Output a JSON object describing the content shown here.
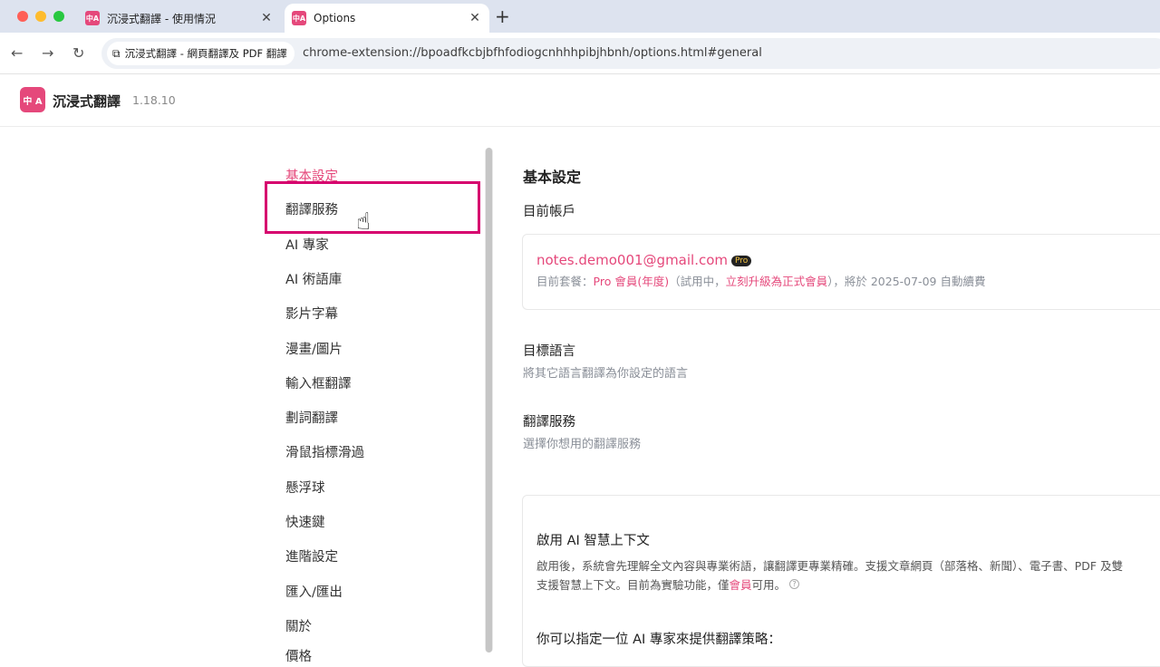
{
  "browser": {
    "tabs": [
      {
        "title": "沉浸式翻譯 - 使用情況",
        "icon": "app-logo-icon"
      },
      {
        "title": "Options",
        "icon": "app-logo-icon"
      }
    ],
    "site_chip": "沉浸式翻譯 - 網頁翻譯及 PDF 翻譯",
    "url": "chrome-extension://bpoadfkcbjbfhfodiogcnhhhpibjhbnh/options.html#general",
    "colors": {
      "accent": "#e5487b"
    }
  },
  "header": {
    "app_name": "沉浸式翻譯",
    "version": "1.18.10",
    "logo_text": "中 A"
  },
  "sidebar": {
    "items": [
      {
        "label": "基本設定"
      },
      {
        "label": "翻譯服務"
      },
      {
        "label": "AI 專家"
      },
      {
        "label": "AI 術語庫"
      },
      {
        "label": "影片字幕"
      },
      {
        "label": "漫畫/圖片"
      },
      {
        "label": "輸入框翻譯"
      },
      {
        "label": "劃詞翻譯"
      },
      {
        "label": "滑鼠指標滑過"
      },
      {
        "label": "懸浮球"
      },
      {
        "label": "快速鍵"
      },
      {
        "label": "進階設定"
      },
      {
        "label": "匯入/匯出"
      },
      {
        "label": "關於"
      },
      {
        "label": "價格"
      }
    ],
    "active": "基本設定",
    "highlighted": "翻譯服務"
  },
  "main": {
    "title": "基本設定",
    "account": {
      "heading": "目前帳戶",
      "email": "notes.demo001@gmail.com",
      "badge": "Pro",
      "plan_prefix": "目前套餐：",
      "plan_name": "Pro 會員(年度)",
      "plan_mid": "（試用中，",
      "upgrade_link": "立刻升級為正式會員",
      "plan_suffix": "），將於 2025-07-09 自動續費"
    },
    "target_language": {
      "title": "目標語言",
      "desc": "將其它語言翻譯為你設定的語言"
    },
    "translation_service": {
      "title": "翻譯服務",
      "desc": "選擇你想用的翻譯服務"
    },
    "ai_context": {
      "title": "啟用 AI 智慧上下文",
      "desc_line1": "啟用後，系統會先理解全文內容與專業術語，讓翻譯更專業精確。支援文章網頁（部落格、新聞）、電子書、PDF 及雙",
      "desc_line2_prefix": "支援智慧上下文。目前為實驗功能，僅",
      "member_link": "會員",
      "desc_line2_suffix": "可用。",
      "expert_prompt": "你可以指定一位 AI 專家來提供翻譯策略："
    }
  }
}
